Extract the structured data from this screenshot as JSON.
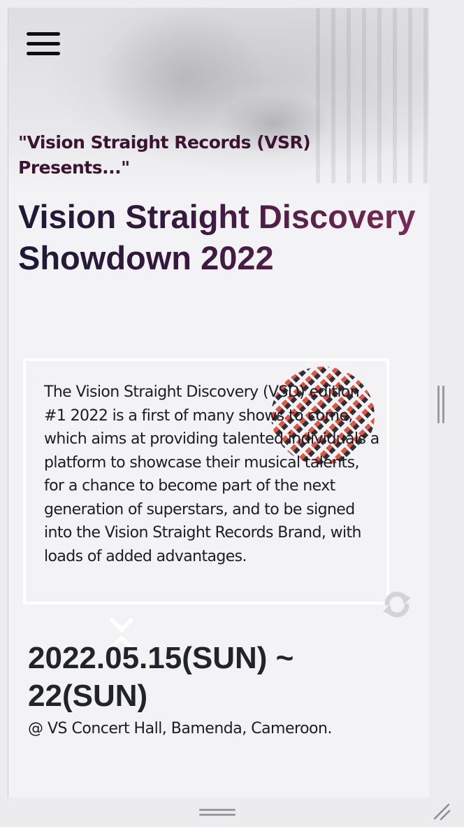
{
  "hero": {
    "menu_icon": "hamburger-menu-icon",
    "kicker": "\"Vision Straight Records (VSR) Presents...\"",
    "title": "Vision Straight Discovery Showdown 2022"
  },
  "about": {
    "description": "The Vision Straight Discovery (VSD) edition #1 2022 is a first of many shows to come, which aims at providing talented individuals a platform to showcase their musical talents, for a chance to become part of the next generation of superstars, and to be signed into the Vision Straight Records Brand, with loads of added advantages."
  },
  "event": {
    "date": "2022.05.15(SUN) ~ 22(SUN)",
    "venue": "@ VS Concert Hall, Bamenda, Cameroon."
  },
  "icons": {
    "refresh": "refresh-icon",
    "decoration": "cross-decoration-icon",
    "dots": "dot-pattern-decoration"
  },
  "colors": {
    "title_start": "#1d1a35",
    "title_end": "#7b2a55",
    "kicker": "#3a1430",
    "dot_accent": "#e0452f",
    "dot_dark": "#1c1c24"
  }
}
